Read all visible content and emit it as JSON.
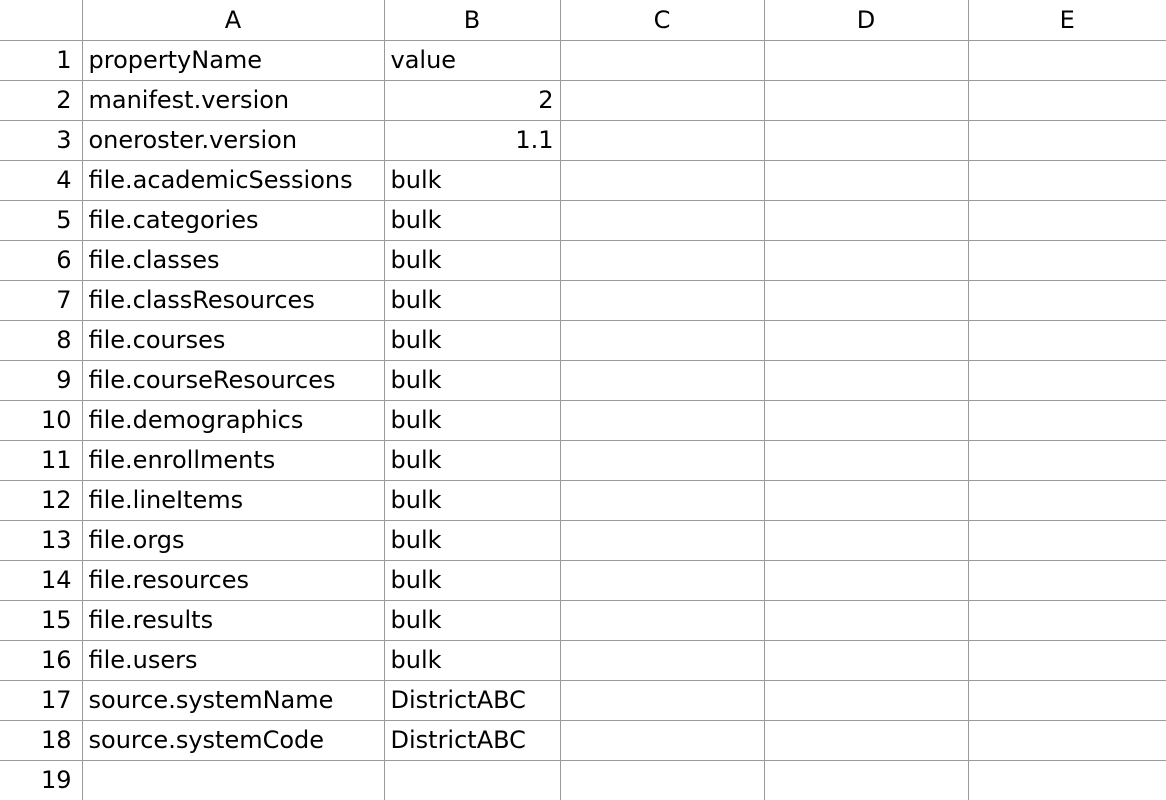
{
  "columns": [
    "A",
    "B",
    "C",
    "D",
    "E"
  ],
  "rowNumbers": [
    "1",
    "2",
    "3",
    "4",
    "5",
    "6",
    "7",
    "8",
    "9",
    "10",
    "11",
    "12",
    "13",
    "14",
    "15",
    "16",
    "17",
    "18",
    "19"
  ],
  "cells": {
    "A1": {
      "v": "propertyName",
      "t": "txt"
    },
    "B1": {
      "v": "value",
      "t": "txt"
    },
    "A2": {
      "v": "manifest.version",
      "t": "txt"
    },
    "B2": {
      "v": "2",
      "t": "num"
    },
    "A3": {
      "v": "oneroster.version",
      "t": "txt"
    },
    "B3": {
      "v": "1.1",
      "t": "num"
    },
    "A4": {
      "v": "file.academicSessions",
      "t": "txt"
    },
    "B4": {
      "v": "bulk",
      "t": "txt"
    },
    "A5": {
      "v": "file.categories",
      "t": "txt"
    },
    "B5": {
      "v": "bulk",
      "t": "txt"
    },
    "A6": {
      "v": "file.classes",
      "t": "txt"
    },
    "B6": {
      "v": "bulk",
      "t": "txt"
    },
    "A7": {
      "v": "file.classResources",
      "t": "txt"
    },
    "B7": {
      "v": "bulk",
      "t": "txt"
    },
    "A8": {
      "v": "file.courses",
      "t": "txt"
    },
    "B8": {
      "v": "bulk",
      "t": "txt"
    },
    "A9": {
      "v": "file.courseResources",
      "t": "txt"
    },
    "B9": {
      "v": "bulk",
      "t": "txt"
    },
    "A10": {
      "v": "file.demographics",
      "t": "txt"
    },
    "B10": {
      "v": "bulk",
      "t": "txt"
    },
    "A11": {
      "v": "file.enrollments",
      "t": "txt"
    },
    "B11": {
      "v": "bulk",
      "t": "txt"
    },
    "A12": {
      "v": "file.lineItems",
      "t": "txt"
    },
    "B12": {
      "v": "bulk",
      "t": "txt"
    },
    "A13": {
      "v": "file.orgs",
      "t": "txt"
    },
    "B13": {
      "v": "bulk",
      "t": "txt"
    },
    "A14": {
      "v": "file.resources",
      "t": "txt"
    },
    "B14": {
      "v": "bulk",
      "t": "txt"
    },
    "A15": {
      "v": "file.results",
      "t": "txt"
    },
    "B15": {
      "v": "bulk",
      "t": "txt"
    },
    "A16": {
      "v": "file.users",
      "t": "txt"
    },
    "B16": {
      "v": "bulk",
      "t": "txt"
    },
    "A17": {
      "v": "source.systemName",
      "t": "txt"
    },
    "B17": {
      "v": "DistrictABC",
      "t": "txt"
    },
    "A18": {
      "v": "source.systemCode",
      "t": "txt"
    },
    "B18": {
      "v": "DistrictABC",
      "t": "txt"
    }
  }
}
